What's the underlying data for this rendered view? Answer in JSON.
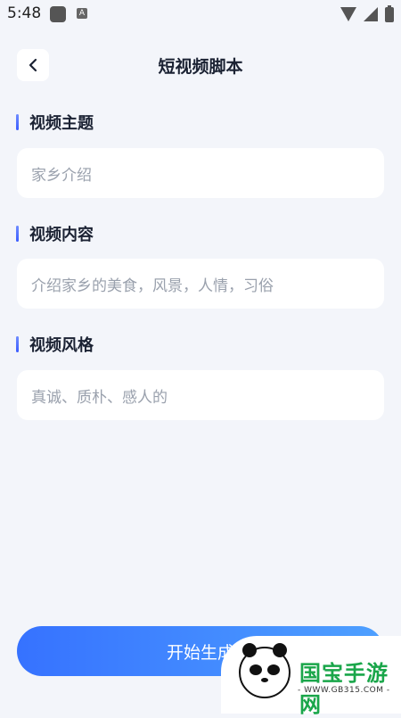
{
  "status_bar": {
    "time": "5:48",
    "app_badge": "A"
  },
  "header": {
    "title": "短视频脚本"
  },
  "sections": [
    {
      "title": "视频主题",
      "placeholder": "家乡介绍"
    },
    {
      "title": "视频内容",
      "placeholder": "介绍家乡的美食，风景，人情，习俗"
    },
    {
      "title": "视频风格",
      "placeholder": "真诚、质朴、感人的"
    }
  ],
  "actions": {
    "start_label": "开始生成"
  },
  "watermark": {
    "brand": "国宝手游网",
    "url": "- WWW.GB315.COM -"
  }
}
